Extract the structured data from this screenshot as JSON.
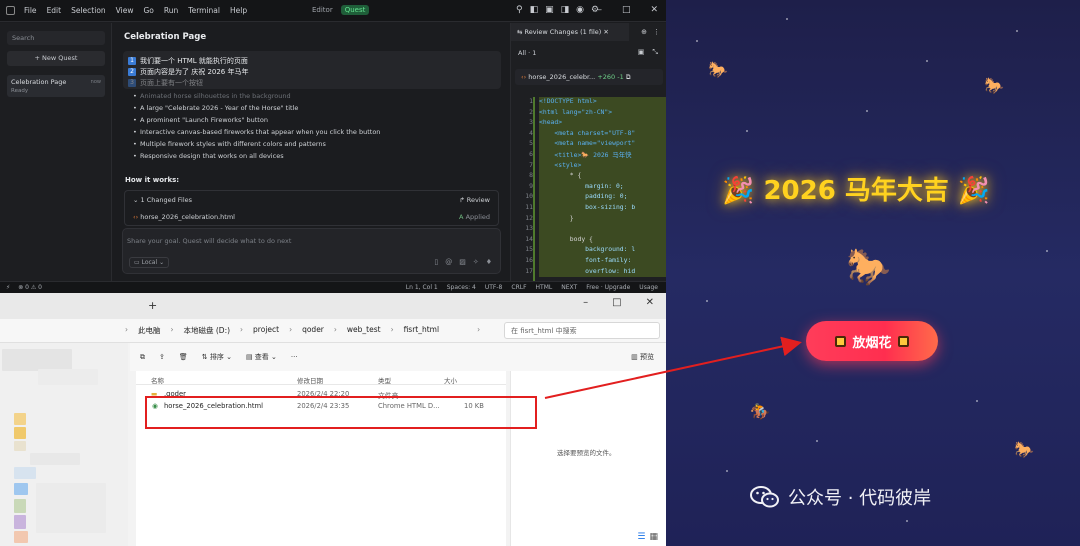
{
  "editor": {
    "menu": [
      "File",
      "Edit",
      "Selection",
      "View",
      "Go",
      "Run",
      "Terminal",
      "Help"
    ],
    "modes": [
      "Editor",
      "Quest"
    ],
    "left": {
      "search_placeholder": "Search",
      "new_quest": "+ New Quest",
      "quest_name": "Celebration Page",
      "quest_status": "Ready",
      "quest_time": "now"
    },
    "chat": {
      "title": "Celebration Page",
      "requests": [
        {
          "n": "1",
          "text": "我们要一个 HTML 就能执行的页面"
        },
        {
          "n": "2",
          "text": "页面内容是为了 庆祝 2026 年马年"
        },
        {
          "n": "3",
          "text": "页面上要有一个按钮"
        }
      ],
      "bullets": [
        "Animated horse silhouettes in the background",
        "A large \"Celebrate 2026 - Year of the Horse\" title",
        "A prominent \"Launch Fireworks\" button",
        "Interactive canvas-based fireworks that appear when you click the button",
        "Multiple firework styles with different colors and patterns",
        "Responsive design that works on all devices"
      ],
      "how_it_works": "How it works:",
      "changed_files": "1 Changed Files",
      "review": "Review",
      "file_name": "horse_2026_celebration.html",
      "applied": "Applied",
      "goal_placeholder": "Share your goal. Quest will decide what to do next",
      "local": "Local"
    },
    "code": {
      "tab": "Review Changes (1 file)",
      "all": "All · 1",
      "file": "horse_2026_celebr...",
      "diff": "+260 -1",
      "lines": [
        {
          "n": "1",
          "t": "<!DOCTYPE html>",
          "add": true
        },
        {
          "n": "2",
          "t": "<html lang=\"zh-CN\">",
          "add": true
        },
        {
          "n": "3",
          "t": "<head>",
          "add": true
        },
        {
          "n": "4",
          "t": "    <meta charset=\"UTF-8\"",
          "add": true
        },
        {
          "n": "5",
          "t": "    <meta name=\"viewport\"",
          "add": true
        },
        {
          "n": "6",
          "t": "    <title>🐎 2026 马年快",
          "add": true
        },
        {
          "n": "7",
          "t": "    <style>",
          "add": true
        },
        {
          "n": "8",
          "t": "        * {",
          "add": true
        },
        {
          "n": "9",
          "t": "            margin: 0;",
          "add": true
        },
        {
          "n": "10",
          "t": "            padding: 0;",
          "add": true
        },
        {
          "n": "11",
          "t": "            box-sizing: b",
          "add": true
        },
        {
          "n": "12",
          "t": "        }",
          "add": true
        },
        {
          "n": "13",
          "t": "",
          "add": true
        },
        {
          "n": "14",
          "t": "        body {",
          "add": true
        },
        {
          "n": "15",
          "t": "            background: l",
          "add": true
        },
        {
          "n": "16",
          "t": "            font-family:",
          "add": true
        },
        {
          "n": "17",
          "t": "            overflow: hid",
          "add": true
        }
      ]
    },
    "status": {
      "left": [
        "⊗ 0 ⚠ 0"
      ],
      "right": [
        "Ln 1, Col 1",
        "Spaces: 4",
        "UTF-8",
        "CRLF",
        "HTML",
        "NEXT",
        "Free · Upgrade",
        "Usage"
      ]
    }
  },
  "explorer": {
    "breadcrumbs": [
      "此电脑",
      "本地磁盘 (D:)",
      "project",
      "qoder",
      "web_test",
      "fisrt_html"
    ],
    "search_placeholder": "在 fisrt_html 中搜索",
    "toolbar": {
      "sort": "排序",
      "view": "查看",
      "more": "···",
      "preview": "预览"
    },
    "columns": [
      "名称",
      "修改日期",
      "类型",
      "大小"
    ],
    "rows": [
      {
        "name": ".qoder",
        "date": "2026/2/4 22:20",
        "type": "文件夹",
        "size": ""
      },
      {
        "name": "horse_2026_celebration.html",
        "date": "2026/2/4 23:35",
        "type": "Chrome HTML D...",
        "size": "10 KB"
      }
    ],
    "preview_message": "选择要预览的文件。"
  },
  "celebration": {
    "headline": "2026 马年大吉",
    "button": "放烟花",
    "watermark": "公众号 · 代码彼岸"
  },
  "colors": {
    "highlight": "#e21f1f",
    "headline": "#ffd21f",
    "button": "#ff3d5a",
    "quest_active": "#63e08f"
  }
}
